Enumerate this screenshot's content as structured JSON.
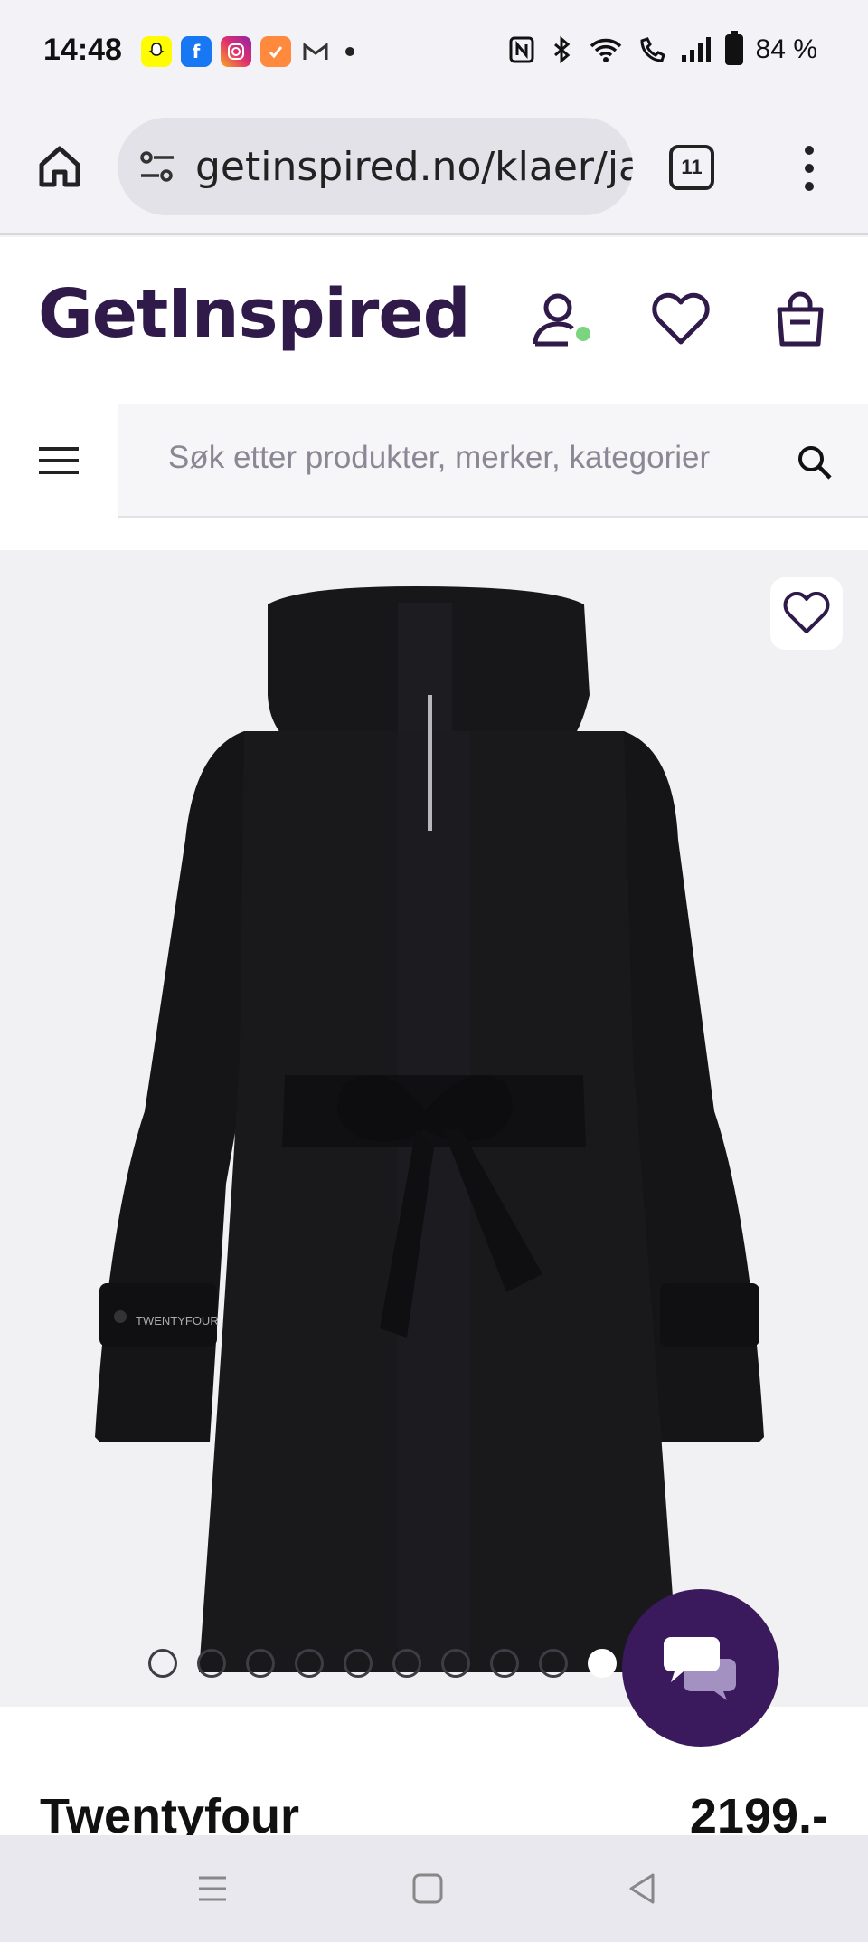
{
  "status_bar": {
    "time": "14:48",
    "notifications": [
      {
        "icon": "snapchat-icon",
        "color": "#fffc00"
      },
      {
        "icon": "facebook-icon",
        "color": "#1877f2"
      },
      {
        "icon": "instagram-icon",
        "color": "#e1306c"
      },
      {
        "icon": "tasks-icon",
        "color": "#ff8a3d"
      },
      {
        "icon": "gmail-icon",
        "color": "#444444"
      }
    ],
    "battery": "84 %"
  },
  "browser": {
    "url": "getinspired.no/klaer/ja",
    "tab_count": "11"
  },
  "site": {
    "logo": "GetInspired",
    "search_placeholder": "Søk etter produkter, merker, kategorier",
    "brand_color": "#2f1a4a",
    "online_indicator_color": "#7bd47e"
  },
  "gallery": {
    "image": "black-belted-hooded-coat",
    "logo_patch_text": "TWENTYFOUR",
    "dots_total": 10,
    "active_dot": 10
  },
  "product": {
    "brand": "Twentyfour",
    "price": "2199.-"
  },
  "chat": {
    "icon": "chat-bubbles-icon",
    "color": "#3a1a5c"
  }
}
